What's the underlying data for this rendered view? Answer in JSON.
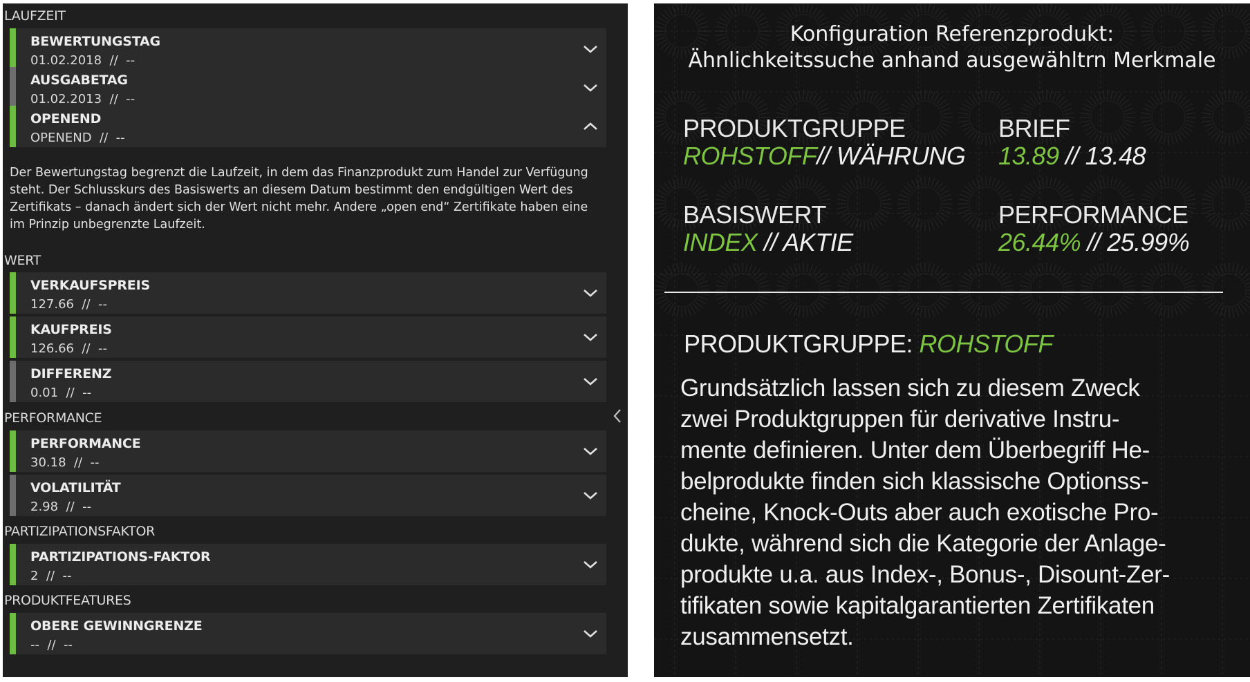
{
  "left": {
    "sections": {
      "laufzeit": "LAUFZEIT",
      "wert": "WERT",
      "performance": "PERFORMANCE",
      "partizipation": "PARTIZIPATIONSFAKTOR",
      "produktfeatures": "PRODUKTFEATURES"
    },
    "rows": [
      {
        "title": "BEWERTUNGSTAG",
        "value": "01.02.2018  //  --",
        "status_color": "#6cbd3f",
        "chevron": "chevron-down"
      },
      {
        "title": "AUSGABETAG",
        "value": "01.02.2013  //  --",
        "status_color": "#6d6d6d",
        "chevron": "chevron-down"
      },
      {
        "title": "OPENEND",
        "value": "OPENEND  //  --",
        "status_color": "#6cbd3f",
        "chevron": "chevron-up"
      },
      {
        "title": "VERKAUFSPREIS",
        "value": "127.66  //  --",
        "status_color": "#6cbd3f",
        "chevron": "chevron-down"
      },
      {
        "title": "KAUFPREIS",
        "value": "126.66  //  --",
        "status_color": "#6cbd3f",
        "chevron": "chevron-down"
      },
      {
        "title": "DIFFERENZ",
        "value": "0.01  //  --",
        "status_color": "#6d6d6d",
        "chevron": "chevron-down"
      },
      {
        "title": "PERFORMANCE",
        "value": "30.18  //  --",
        "status_color": "#6cbd3f",
        "chevron": "chevron-down"
      },
      {
        "title": "VOLATILITÄT",
        "value": "2.98  //  --",
        "status_color": "#6d6d6d",
        "chevron": "chevron-down"
      },
      {
        "title": "PARTIZIPATIONS-FAKTOR",
        "value": "2  //  --",
        "status_color": "#6cbd3f",
        "chevron": "chevron-down"
      },
      {
        "title": "OBERE GEWINNGRENZE",
        "value": "--  //  --",
        "status_color": "#6cbd3f",
        "chevron": "chevron-down"
      }
    ],
    "description": "Der Bewertungstag begrenzt die Laufzeit, in dem das Finanzprodukt zum Handel zur Verfügung steht. Der Schlusskurs des Basiswerts an diesem Datum bestimmt den endgültigen Wert des Zertifikats – danach ändert sich der Wert nicht mehr. Andere „open end“ Zertifikate haben eine im Prinzip unbegrenzte Laufzeit.",
    "collapse_icon": "chevron-left"
  },
  "right": {
    "title_line1": "Konfiguration Referenzprodukt:",
    "title_line2": "Ähnlichkeitssuche anhand ausgewähltrn Merkmale",
    "produktgruppe": {
      "label": "PRODUKTGRUPPE",
      "value_a": "ROHSTOFF",
      "value_b": "// WÄHRUNG"
    },
    "brief": {
      "label": "BRIEF",
      "value_a": "13.89",
      "value_b": " // 13.48"
    },
    "basiswert": {
      "label": "BASISWERT",
      "value_a": "INDEX",
      "value_b": " // AKTIE"
    },
    "performance": {
      "label": "PERFORMANCE",
      "value_a": "26.44%",
      "value_b": " //  25.99%"
    },
    "detail_heading": "PRODUKTGRUPPE: ",
    "detail_heading_value": "ROHSTOFF",
    "paragraph_lines": [
      "Grundsätzlich lassen sich zu diesem Zweck",
      "zwei Produktgruppen für derivative Instru-",
      "mente definieren. Unter dem Überbegriff He-",
      "belprodukte finden sich klassische Optionss-",
      "cheine, Knock-Outs aber auch exotische Pro-",
      "dukte, während sich die Kategorie der Anlage-",
      "produkte u.a. aus Index-, Bonus-, Disount-Zer-",
      "tifikaten sowie kapitalgarantierten Zertifikaten",
      "zusammensetzt."
    ],
    "accent_color": "#7cc441"
  }
}
